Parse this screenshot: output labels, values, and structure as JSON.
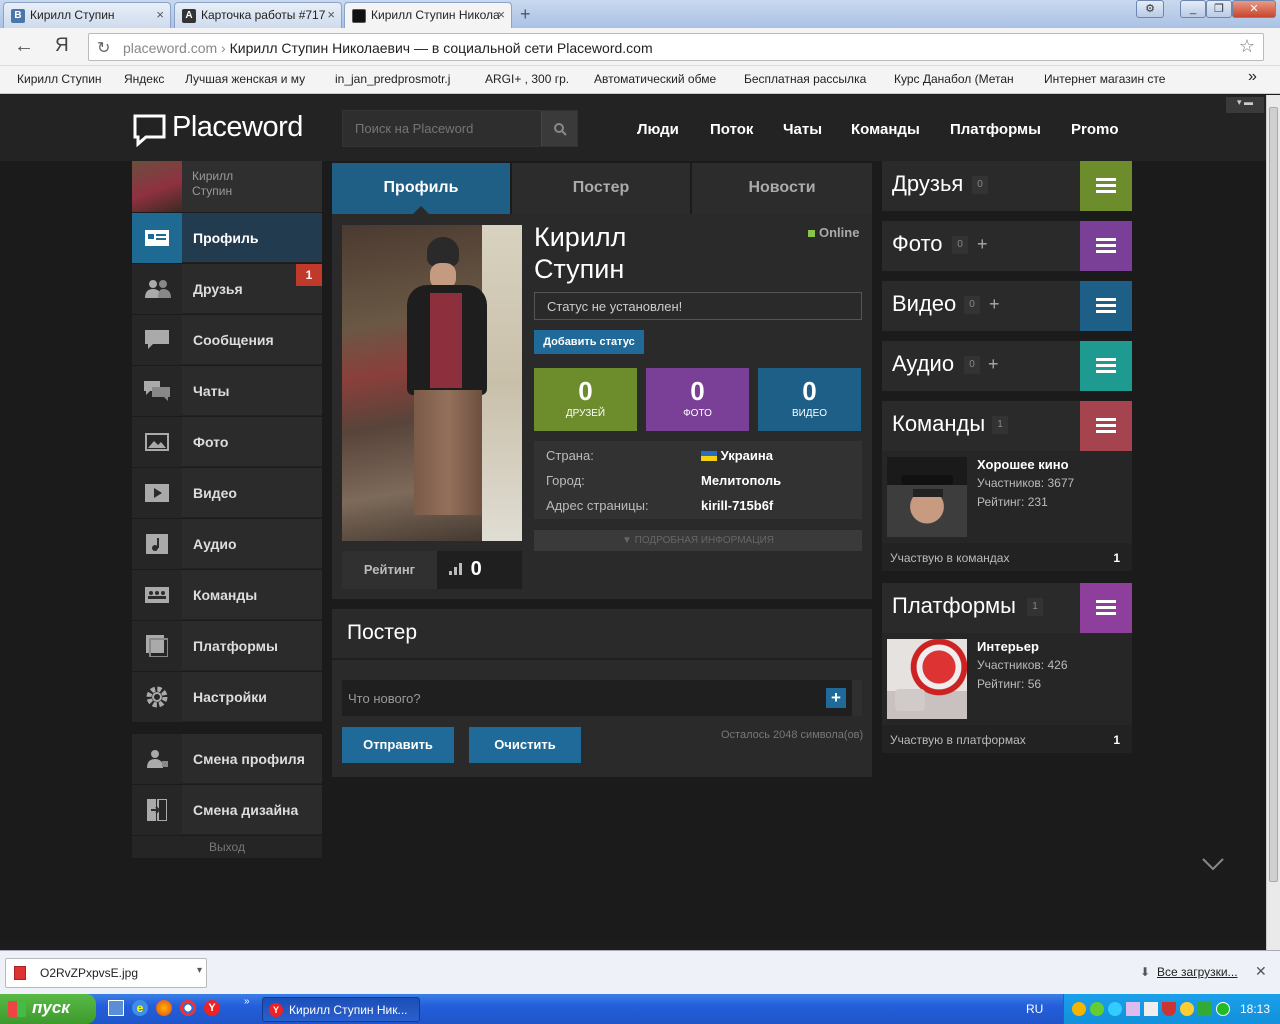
{
  "browser": {
    "tabs": [
      {
        "label": "Кирилл Ступин",
        "favicon": "В"
      },
      {
        "label": "Карточка работы #717",
        "favicon": "A"
      },
      {
        "label": "Кирилл Ступин Никола",
        "favicon": "P"
      }
    ],
    "url_domain": "placeword.com",
    "url_rest": "Кирилл Ступин Николаевич — в социальной сети Placeword.com",
    "bookmarks": [
      "Кирилл Ступин",
      "Яндекс",
      "Лучшая женская и му",
      "in_jan_predprosmotr.j",
      "ARGI+ , 300 гр.",
      "Автоматический обме",
      "Бесплатная рассылка",
      "Курс Данабол (Метан",
      "Интернет магазин сте"
    ]
  },
  "site": {
    "logo": "Placeword",
    "search_placeholder": "Поиск на Placeword",
    "nav": [
      "Люди",
      "Поток",
      "Чаты",
      "Команды",
      "Платформы",
      "Promo"
    ]
  },
  "sidebar": {
    "user_first": "Кирилл",
    "user_last": "Ступин",
    "items": [
      {
        "label": "Профиль"
      },
      {
        "label": "Друзья",
        "badge": "1"
      },
      {
        "label": "Сообщения"
      },
      {
        "label": "Чаты"
      },
      {
        "label": "Фото"
      },
      {
        "label": "Видео"
      },
      {
        "label": "Аудио"
      },
      {
        "label": "Команды"
      },
      {
        "label": "Платформы"
      },
      {
        "label": "Настройки"
      }
    ],
    "extra": [
      {
        "label": "Смена профиля"
      },
      {
        "label": "Смена дизайна"
      }
    ],
    "logout": "Выход"
  },
  "center": {
    "tabs": [
      "Профиль",
      "Постер",
      "Новости"
    ],
    "name_first": "Кирилл",
    "name_last": "Ступин",
    "online": "Online",
    "status": "Статус не установлен!",
    "add_status": "Добавить статус",
    "stats": [
      {
        "n": "0",
        "l": "ДРУЗЕЙ",
        "color": "#6d8c2c"
      },
      {
        "n": "0",
        "l": "ФОТО",
        "color": "#7a3f96"
      },
      {
        "n": "0",
        "l": "ВИДЕО",
        "color": "#1e5f87"
      }
    ],
    "info": [
      {
        "k": "Страна:",
        "v": "Украина"
      },
      {
        "k": "Город:",
        "v": "Мелитополь"
      },
      {
        "k": "Адрес страницы:",
        "v": "kirill-715b6f"
      }
    ],
    "more_info": "ПОДРОБНАЯ ИНФОРМАЦИЯ",
    "rating_label": "Рейтинг",
    "rating_value": "0",
    "poster_title": "Постер",
    "poster_placeholder": "Что нового?",
    "send": "Отправить",
    "clear": "Очистить",
    "chars_left": "Осталось 2048 символа(ов)"
  },
  "right": {
    "widgets": [
      {
        "title": "Друзья",
        "count": "0",
        "color": "#6d8c2c"
      },
      {
        "title": "Фото",
        "count": "0",
        "color": "#7a3f96"
      },
      {
        "title": "Видео",
        "count": "0",
        "color": "#1e5f87"
      },
      {
        "title": "Аудио",
        "count": "0",
        "color": "#1e9a90"
      },
      {
        "title": "Команды",
        "count": "1",
        "color": "#a5434f"
      },
      {
        "title": "Платформы",
        "count": "1",
        "color": "#8e3f9c"
      }
    ],
    "team": {
      "name": "Хорошее кино",
      "members": "Участников: 3677",
      "rating": "Рейтинг: 231",
      "footer": "Участвую в командах",
      "footer_count": "1"
    },
    "platform": {
      "name": "Интерьер",
      "members": "Участников: 426",
      "rating": "Рейтинг: 56",
      "footer": "Участвую в платформах",
      "footer_count": "1"
    }
  },
  "downloads": {
    "file": "O2RvZPxpvsE.jpg",
    "all": "Все загрузки..."
  },
  "taskbar": {
    "start": "пуск",
    "window": "Кирилл Ступин Ник...",
    "lang": "RU",
    "time": "18:13"
  }
}
